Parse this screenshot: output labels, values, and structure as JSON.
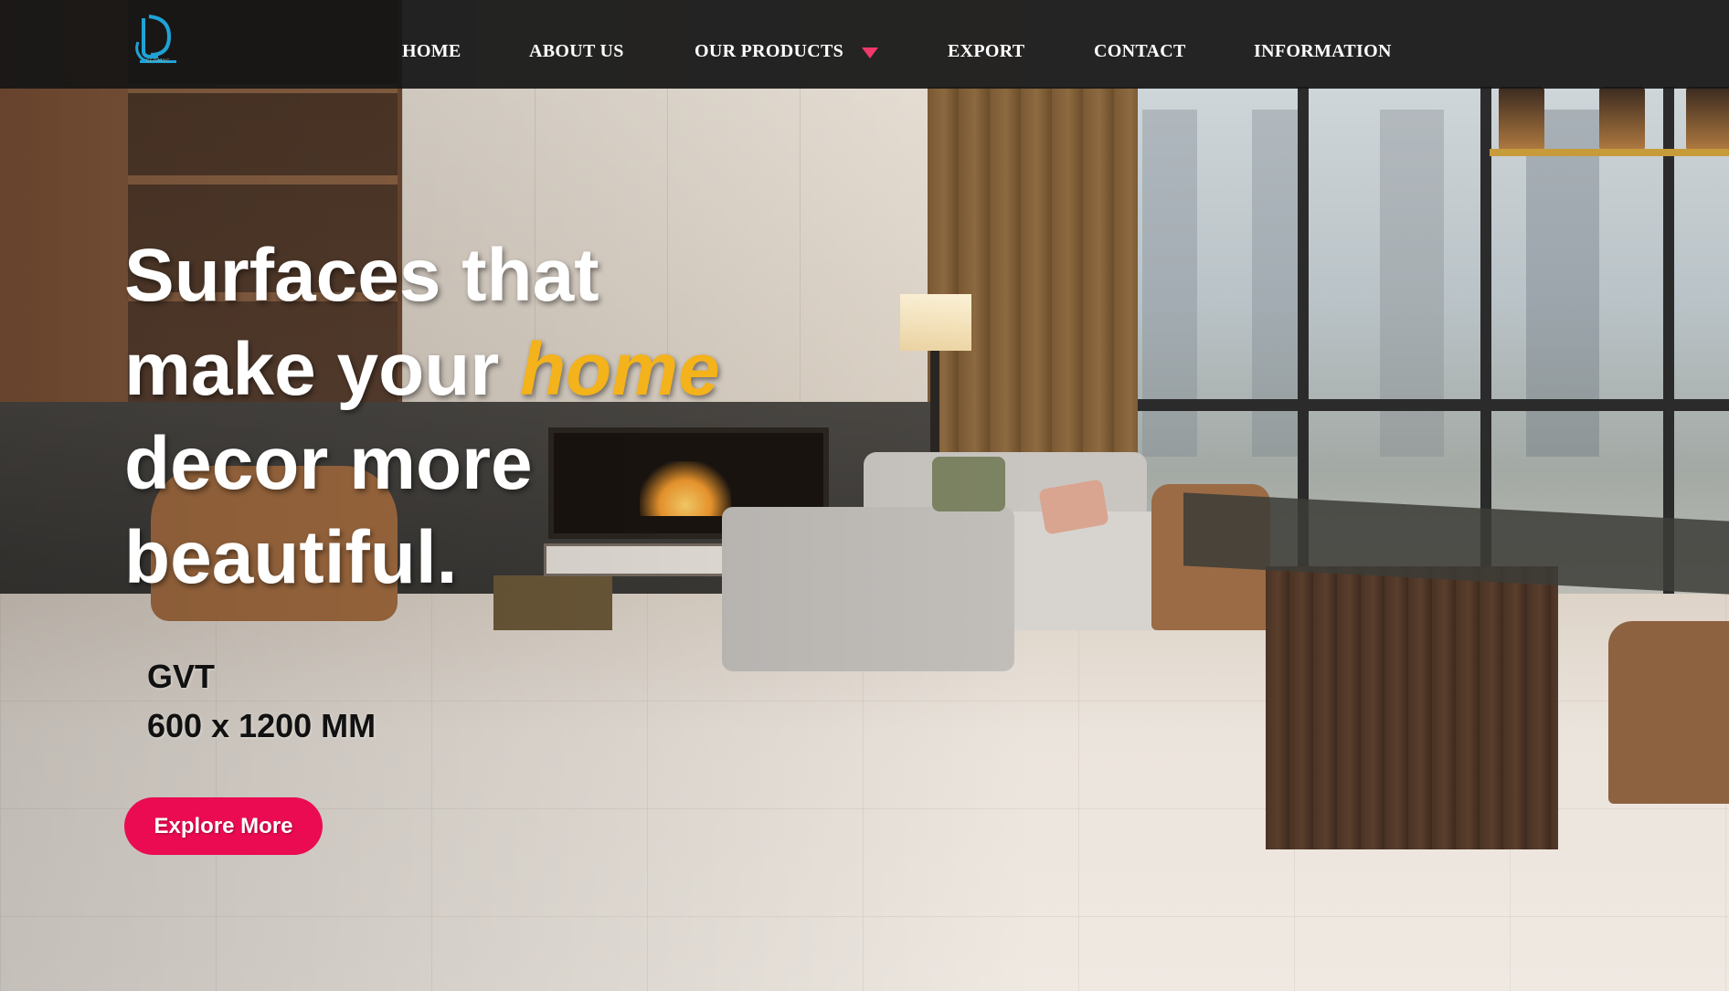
{
  "navbar": {
    "logo_icon": "company-logo-icon",
    "logo_caption": "CERAMIC",
    "items": [
      {
        "label": "HOME"
      },
      {
        "label": "ABOUT US"
      },
      {
        "label": "OUR PRODUCTS",
        "has_dropdown": true
      },
      {
        "label": "EXPORT"
      },
      {
        "label": "CONTACT"
      },
      {
        "label": "INFORMATION"
      }
    ],
    "dropdown_icon": "caret-down-icon",
    "background_color": "#161616",
    "caret_color": "#f0386b"
  },
  "hero": {
    "title_line1": "Surfaces that",
    "title_line2_pre": "make your ",
    "title_line2_accent": "home",
    "title_line3": "decor more",
    "title_line4": "beautiful.",
    "accent_color": "#f4b21b",
    "subtitle_line1": "GVT",
    "subtitle_line2": "600 x 1200 MM",
    "cta_label": "Explore More",
    "cta_color": "#ea0b52"
  }
}
